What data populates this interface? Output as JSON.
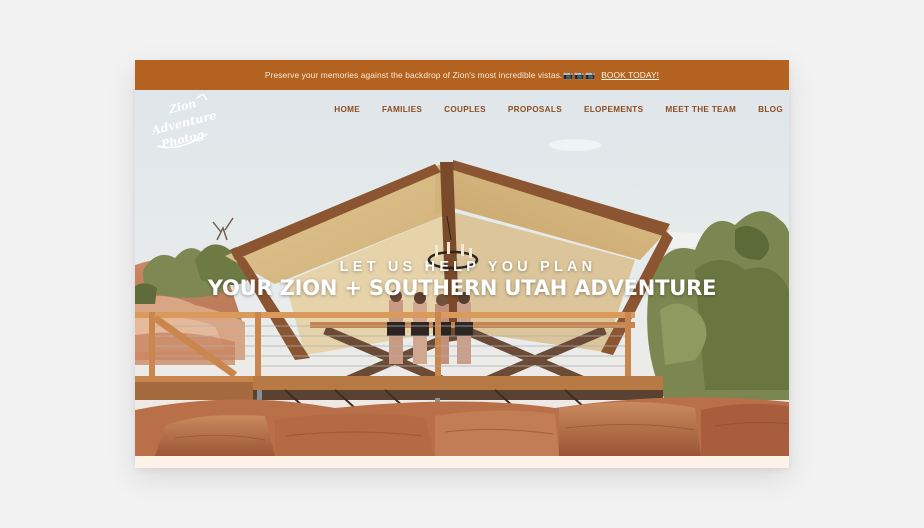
{
  "announcement": {
    "message": "Preserve your memories against the backdrop of Zion's most incredible vistas.",
    "camera_icons": "📷📷📷",
    "cta_label": "BOOK TODAY!"
  },
  "logo": {
    "lines": [
      "Zion",
      "Adventure",
      "Photog"
    ]
  },
  "nav": {
    "items": [
      "HOME",
      "FAMILIES",
      "COUPLES",
      "PROPOSALS",
      "ELOPEMENTS",
      "MEET THE TEAM",
      "BLOG"
    ]
  },
  "hero": {
    "subheading": "LET US HELP YOU PLAN",
    "heading": "YOUR ZION + SOUTHERN UTAH ADVENTURE"
  },
  "colors": {
    "announcement_bg": "#b3631f",
    "nav_text": "#8d4f22",
    "page_bg": "#f2f2f3"
  }
}
